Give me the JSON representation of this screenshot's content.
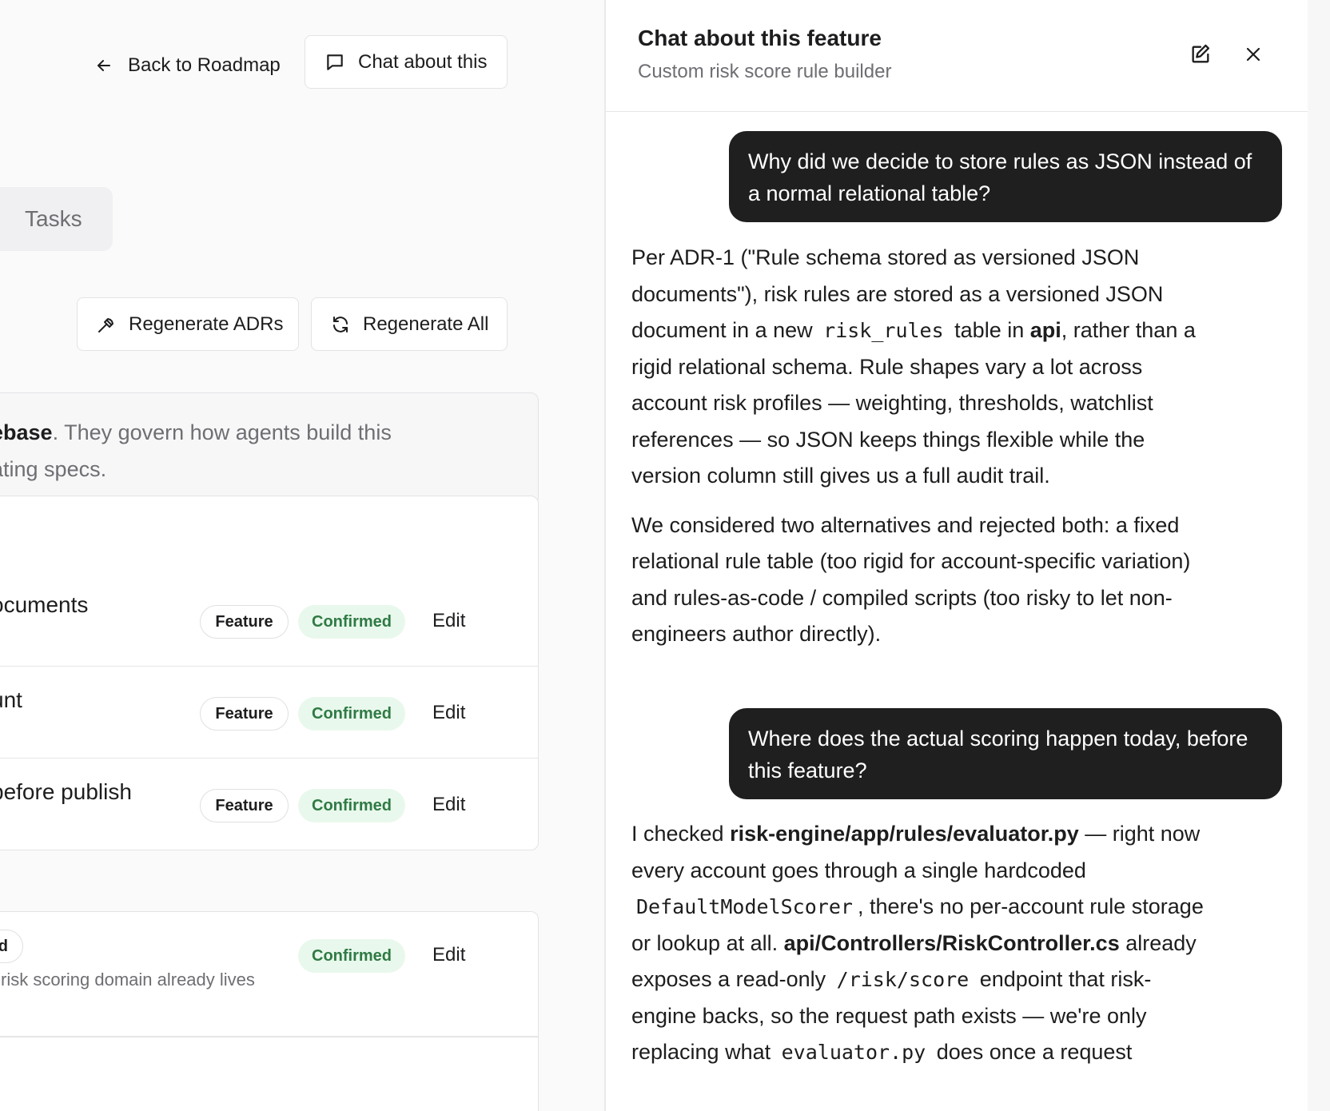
{
  "header": {
    "back_label": "Back to Roadmap",
    "chat_button_label": "Chat about this"
  },
  "tabs": {
    "tasks_label": "Tasks"
  },
  "actions": {
    "regenerate_adrs_label": "Regenerate ADRs",
    "regenerate_all_label": "Regenerate All"
  },
  "info": {
    "line1_bold": "ebase",
    "line1_rest": ". They govern how agents build this",
    "line2": "ating specs."
  },
  "adr_rows": [
    {
      "title": "ocuments",
      "type": "Feature",
      "status": "Confirmed",
      "edit": "Edit"
    },
    {
      "title": "unt",
      "type": "Feature",
      "status": "Confirmed",
      "edit": "Edit"
    },
    {
      "title": "before publish",
      "type": "Feature",
      "status": "Confirmed",
      "edit": "Edit"
    }
  ],
  "context_row": {
    "pill_fragment": "d",
    "description": "risk scoring domain already lives",
    "status": "Confirmed",
    "edit": "Edit"
  },
  "chat": {
    "title": "Chat about this feature",
    "subtitle": "Custom risk score rule builder",
    "edit_icon": "edit-icon",
    "close_icon": "close-icon",
    "messages": [
      {
        "role": "user",
        "text": "Why did we decide to store rules as JSON instead of a normal relational table?"
      },
      {
        "role": "assistant",
        "p1_a": "Per ADR-1 (\"Rule schema stored as versioned JSON documents\"), risk rules are stored as a versioned JSON document in a new ",
        "p1_code": "risk_rules",
        "p1_b": " table in ",
        "p1_bold": "api",
        "p1_c": ", rather than a rigid relational schema. Rule shapes vary a lot across account risk profiles — weighting, thresholds, watchlist references — so JSON keeps things flexible while the version column still gives us a full audit trail.",
        "p2": "We considered two alternatives and rejected both: a fixed relational rule table (too rigid for account-specific variation) and rules-as-code / compiled scripts (too risky to let non-engineers author directly)."
      },
      {
        "role": "user",
        "text": "Where does the actual scoring happen today, before this feature?"
      },
      {
        "role": "assistant",
        "a1": "I checked ",
        "bold1": "risk-engine/app/rules/evaluator.py",
        "a2": " — right now every account goes through a single hardcoded ",
        "code1": "DefaultModelScorer",
        "a3": ", there's no per-account rule storage or lookup at all. ",
        "bold2": "api/Controllers/RiskController.cs",
        "a4": " already exposes a read-only ",
        "code2": "/risk/score",
        "a5": " endpoint that risk-engine backs, so the request path exists — we're only replacing what ",
        "code3": "evaluator.py",
        "a6": " does once a request"
      }
    ]
  }
}
